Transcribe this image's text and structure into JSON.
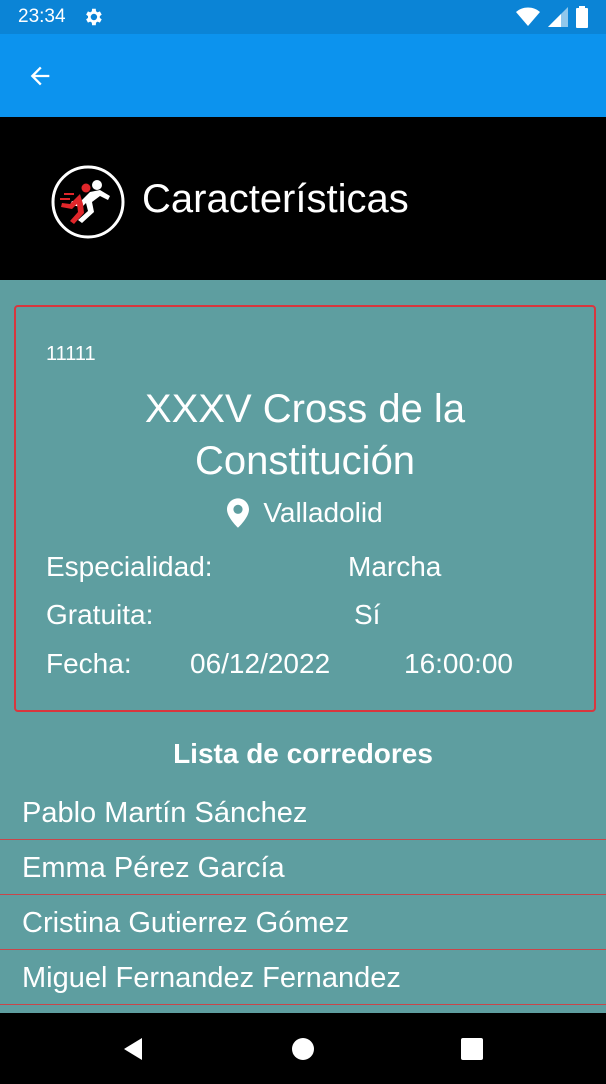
{
  "status": {
    "time": "23:34"
  },
  "header": {
    "title": "Características"
  },
  "race": {
    "id": "11111",
    "title_line1": "XXXV Cross de la",
    "title_line2": "Constitución",
    "location": "Valladolid",
    "especialidad_label": "Especialidad:",
    "especialidad_value": "Marcha",
    "gratuita_label": "Gratuita:",
    "gratuita_value": "Sí",
    "fecha_label": "Fecha:",
    "fecha_date": "06/12/2022",
    "fecha_time": "16:00:00"
  },
  "runners": {
    "title": "Lista de corredores",
    "items": [
      "Pablo Martín Sánchez",
      "Emma Pérez García",
      "Cristina Gutierrez Gómez",
      "Miguel Fernandez Fernandez"
    ]
  },
  "icons": {
    "back": "arrow-back-icon",
    "location": "location-pin-icon",
    "settings": "gear-icon"
  },
  "colors": {
    "app_bar": "#0c93ee",
    "status_bar": "#0b84d6",
    "background": "#5e9ea0",
    "border": "#d9363e"
  }
}
